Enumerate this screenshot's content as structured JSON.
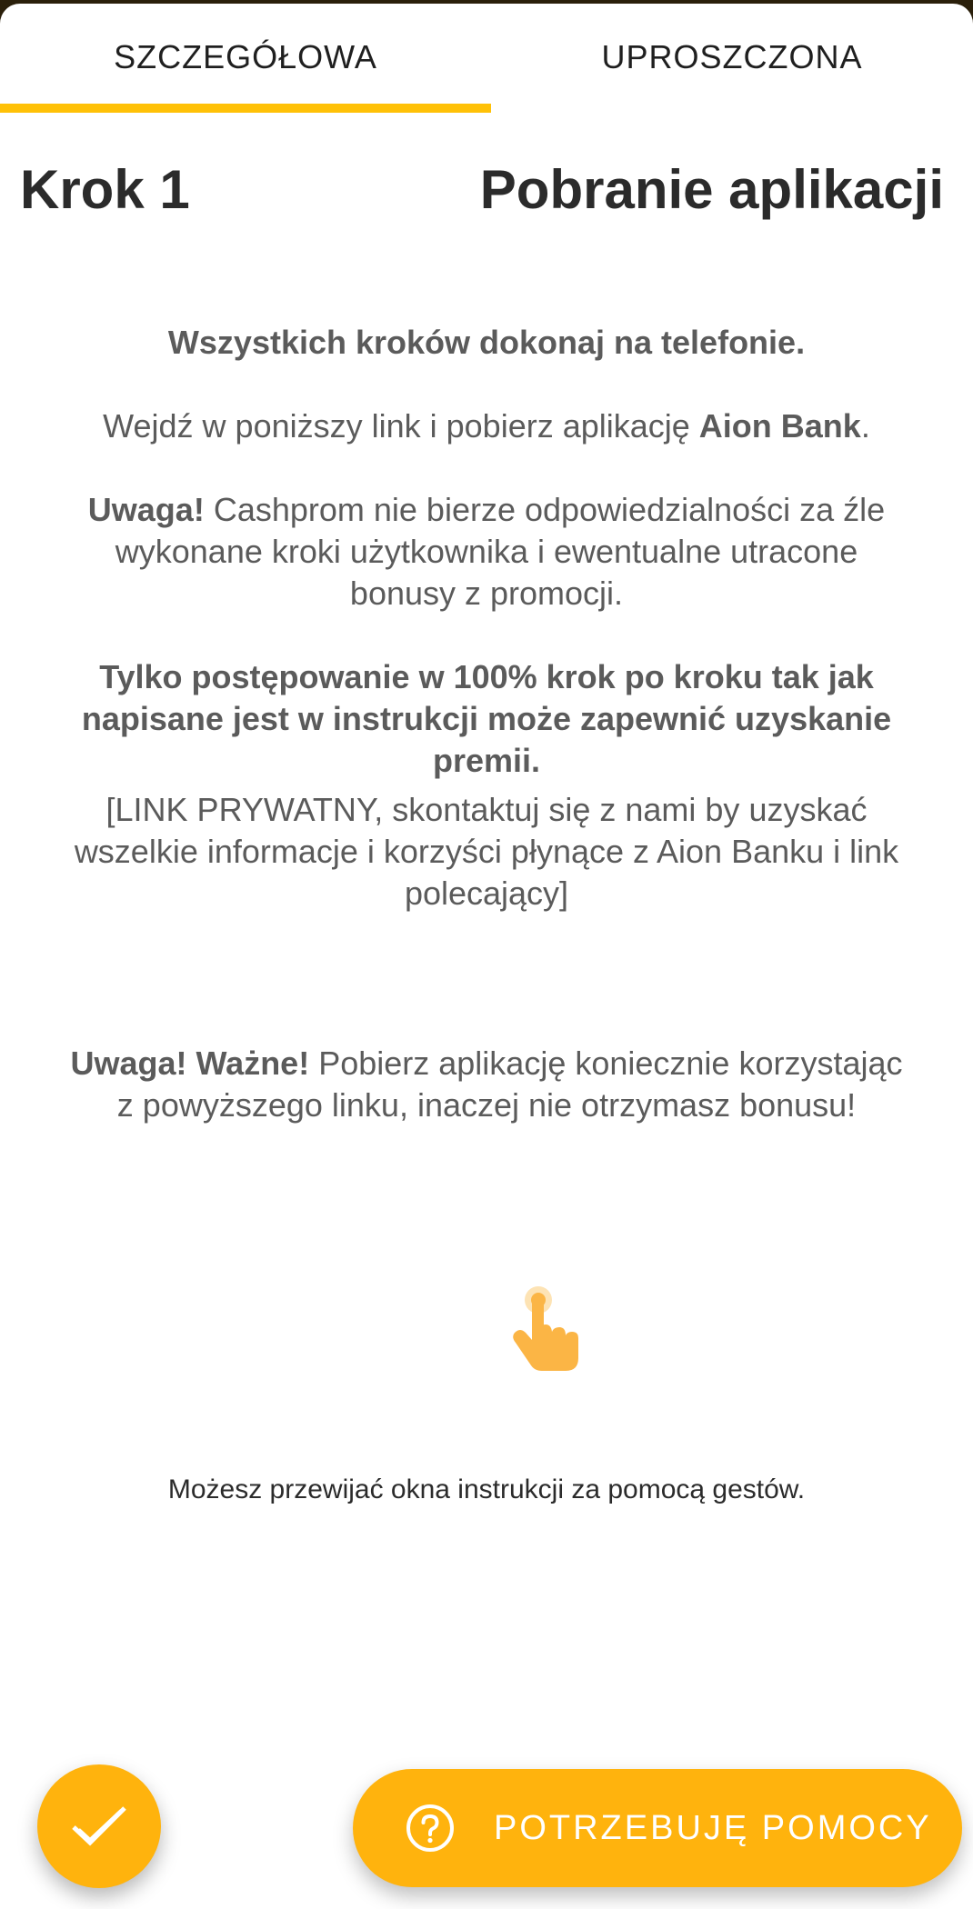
{
  "tabs": {
    "detailed": "SZCZEGÓŁOWA",
    "simplified": "UPROSZCZONA",
    "active": "detailed"
  },
  "header": {
    "step": "Krok 1",
    "title": "Pobranie aplikacji"
  },
  "content": {
    "p1": "Wszystkich kroków dokonaj na telefonie.",
    "p2_text": "Wejdź w poniższy link i pobierz aplikację ",
    "p2_bold": "Aion Bank",
    "p2_end": ".",
    "p3_bold": "Uwaga!",
    "p3_text": " Cashprom nie bierze odpowiedzialności za źle wykonane kroki użytkownika i ewentualne utracone bonusy z promocji.",
    "p4": "Tylko postępowanie w 100% krok po kroku tak jak napisane jest w instrukcji może zapewnić uzyskanie premii.",
    "p5": "[LINK PRYWATNY, skontaktuj się z nami by uzyskać wszelkie informacje i korzyści płynące z Aion Banku i link polecający]"
  },
  "warning": {
    "bold": "Uwaga! Ważne!",
    "text": " Pobierz aplikację koniecznie korzystając z powyższego linku, inaczej nie otrzymasz bonusu!"
  },
  "gesture": {
    "icon": "tap-gesture-icon",
    "hint": "Możesz przewijać okna instrukcji za pomocą gestów."
  },
  "buttons": {
    "done_icon": "checkmark-icon",
    "help_icon": "question-circle-icon",
    "help_label": "POTRZEBUJĘ POMOCY"
  },
  "colors": {
    "accent": "#ffb30d",
    "tab_indicator": "#ffc107",
    "gesture_hand": "#fbb545"
  }
}
